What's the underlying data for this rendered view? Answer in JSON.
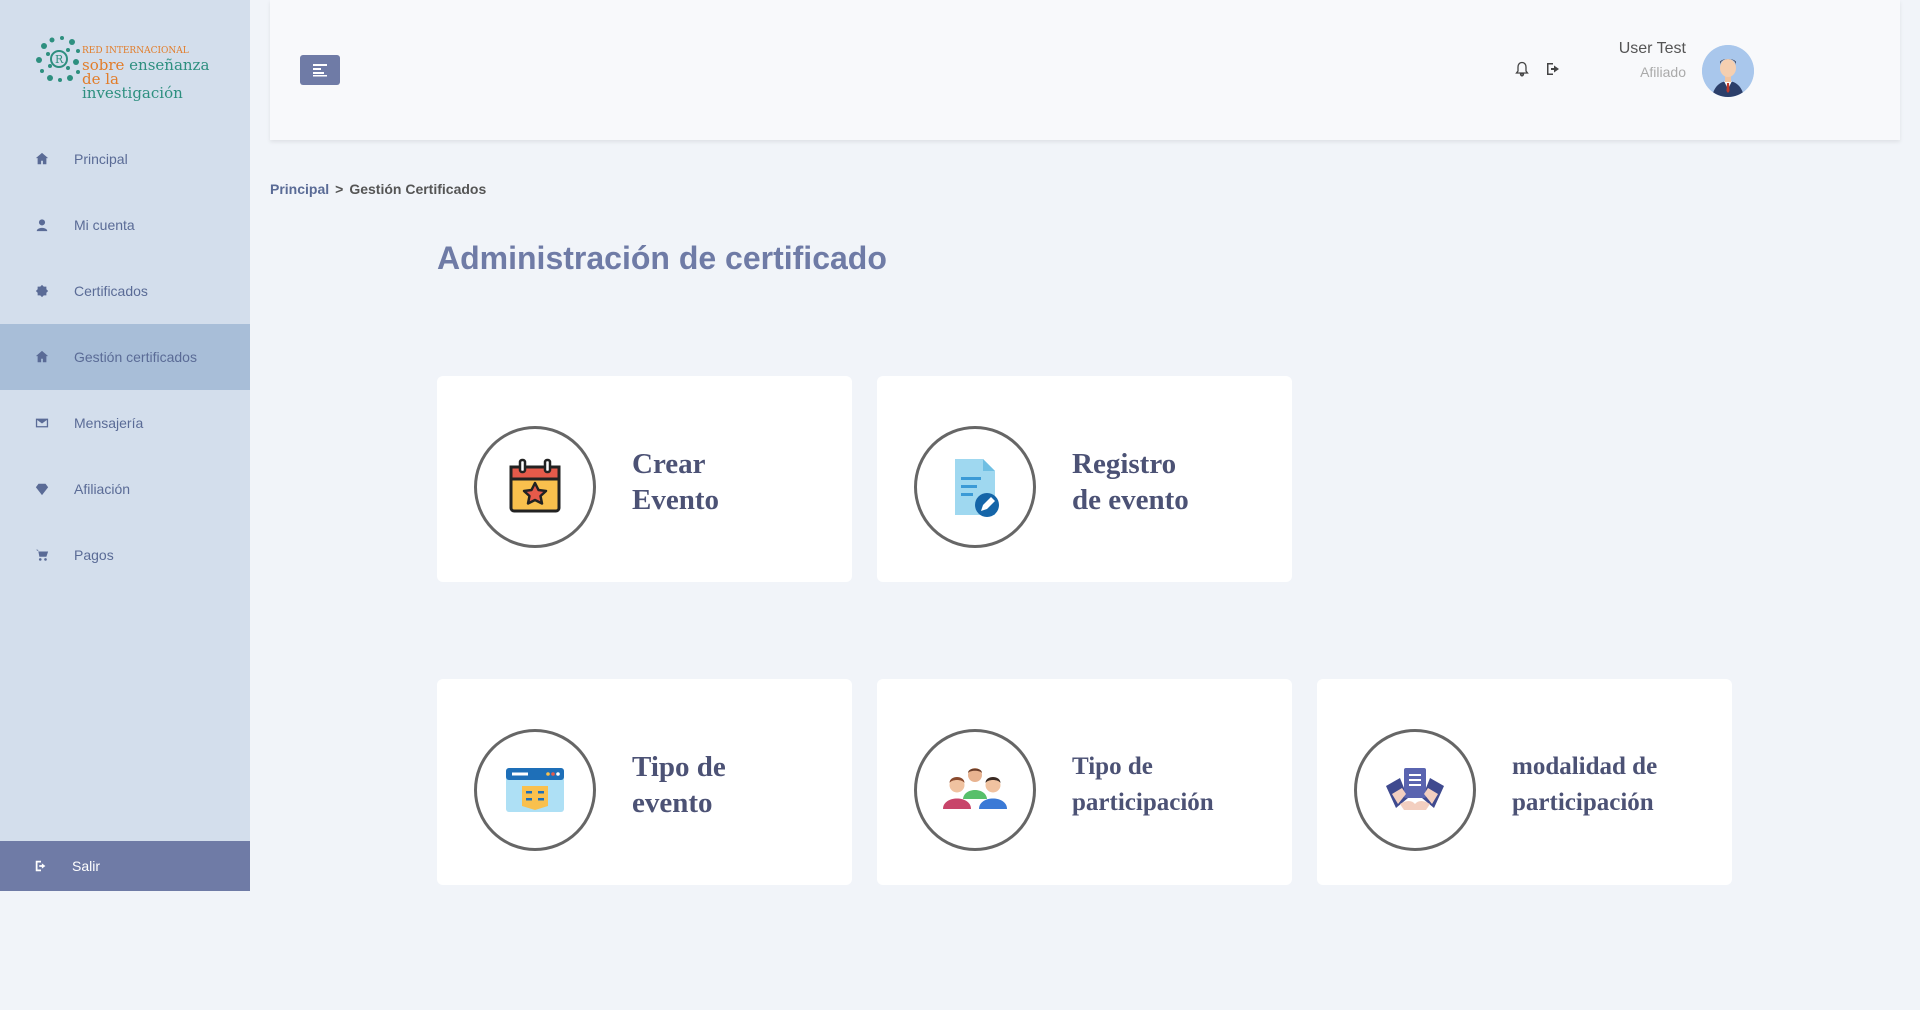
{
  "logo": {
    "line1": "RED INTERNACIONAL",
    "line2_a": "sobre",
    "line2_b": "enseñanza",
    "line3_a": "de la",
    "line3_b": "investigación"
  },
  "sidebar": {
    "items": [
      {
        "label": "Principal",
        "icon": "home-icon"
      },
      {
        "label": "Mi cuenta",
        "icon": "user-icon"
      },
      {
        "label": "Certificados",
        "icon": "certificate-icon"
      },
      {
        "label": "Gestión certificados",
        "icon": "home-icon",
        "active": true
      },
      {
        "label": "Mensajería",
        "icon": "envelope-icon"
      },
      {
        "label": "Afiliación",
        "icon": "diamond-icon"
      },
      {
        "label": "Pagos",
        "icon": "cart-icon"
      }
    ],
    "logout_label": "Salir"
  },
  "header": {
    "user_name": "User Test",
    "user_role": "Afiliado"
  },
  "breadcrumb": {
    "home": "Principal",
    "separator": ">",
    "current": "Gestión Certificados"
  },
  "page_title": "Administración de certificado",
  "cards": [
    {
      "label": "Crear\nEvento",
      "icon": "calendar-star-icon"
    },
    {
      "label": "Registro\nde evento",
      "icon": "document-edit-icon"
    },
    {
      "label": "Tipo de\nevento",
      "icon": "browser-window-icon"
    },
    {
      "label": "Tipo de\nparticipación",
      "icon": "group-people-icon"
    },
    {
      "label": "modalidad de\nparticipación",
      "icon": "hands-document-icon"
    }
  ],
  "colors": {
    "sidebar_bg": "#d3deec",
    "sidebar_active": "#a8bed8",
    "accent": "#6f7ba6",
    "page_bg": "#f1f4f9"
  }
}
